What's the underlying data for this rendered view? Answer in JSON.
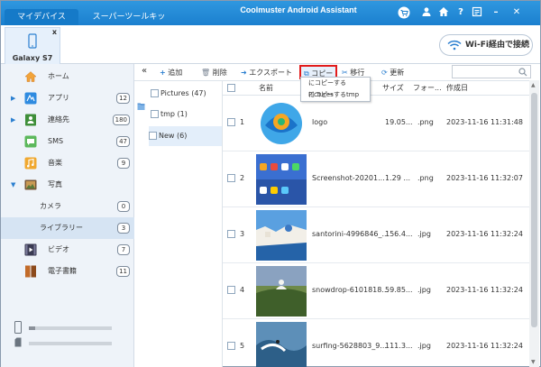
{
  "titlebar": {
    "tabs": [
      "マイデバイス",
      "スーパーツールキット"
    ],
    "app_title": "Coolmuster Android Assistant",
    "icons": [
      "cart-icon",
      "user-icon",
      "home-icon",
      "help-icon",
      "feedback-icon",
      "minimize-icon",
      "close-icon"
    ]
  },
  "device": {
    "name": "Galaxy S7",
    "close": "x"
  },
  "wifi": {
    "label": "Wi-Fi経由で接続"
  },
  "sidebar": {
    "items": [
      {
        "label": "ホーム",
        "count": ""
      },
      {
        "label": "アプリ",
        "count": "12"
      },
      {
        "label": "連絡先",
        "count": "180"
      },
      {
        "label": "SMS",
        "count": "47"
      },
      {
        "label": "音楽",
        "count": "9"
      },
      {
        "label": "写真",
        "count": ""
      },
      {
        "label": "カメラ",
        "count": "0"
      },
      {
        "label": "ライブラリー",
        "count": "3"
      },
      {
        "label": "ビデオ",
        "count": "7"
      },
      {
        "label": "電子書籍",
        "count": "11"
      }
    ],
    "storage": [
      {
        "fill": 0.08
      },
      {
        "fill": 0.0
      }
    ]
  },
  "toolbar": {
    "collapse": "«",
    "add": "追加",
    "delete": "削除",
    "export": "エクスポート",
    "copy": "コピー",
    "move": "移行",
    "refresh": "更新"
  },
  "copy_menu": {
    "items": [
      "にコピーするPictures",
      "にコピーするtmp"
    ]
  },
  "folders": [
    {
      "label": "Pictures (47)"
    },
    {
      "label": "tmp (1)"
    },
    {
      "label": "New (6)"
    }
  ],
  "table": {
    "headers": [
      "名前",
      "サイズ",
      "フォー...",
      "作成日"
    ],
    "rows": [
      {
        "idx": "1",
        "name": "logo",
        "size": "19.05...",
        "format": ".png",
        "date": "2023-11-16 11:31:48"
      },
      {
        "idx": "2",
        "name": "Screenshot-20201...",
        "size": "1.29 ...",
        "format": ".png",
        "date": "2023-11-16 11:32:07"
      },
      {
        "idx": "3",
        "name": "santorini-4996846_...",
        "size": "156.4...",
        "format": ".jpg",
        "date": "2023-11-16 11:32:24"
      },
      {
        "idx": "4",
        "name": "snowdrop-6101818...",
        "size": "59.85...",
        "format": ".jpg",
        "date": "2023-11-16 11:32:24"
      },
      {
        "idx": "5",
        "name": "surfing-5628803_9...",
        "size": "111.3...",
        "format": ".jpg",
        "date": "2023-11-16 11:32:24"
      }
    ]
  }
}
